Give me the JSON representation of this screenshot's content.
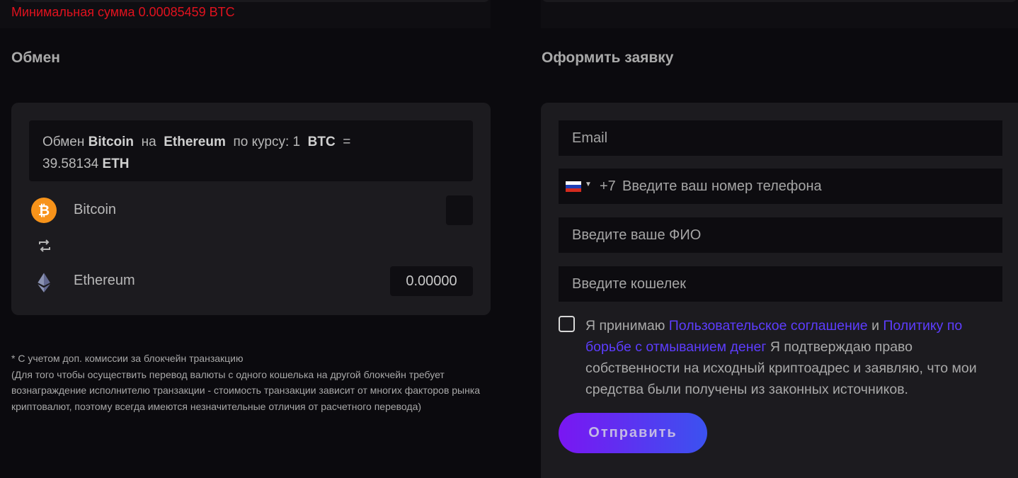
{
  "min_sum": "Минимальная сумма 0.00085459 BTC",
  "exchange": {
    "title": "Обмен",
    "rate": {
      "prefix": "Обмен",
      "from": "Bitcoin",
      "on": "на",
      "to": "Ethereum",
      "rate_label": "по курсу: 1",
      "from_code": "BTC",
      "equals": "=",
      "value": "39.58134",
      "to_code": "ETH"
    },
    "from_coin": {
      "name": "Bitcoin",
      "icon": "bitcoin-icon",
      "color": "#f7931a",
      "value": ""
    },
    "swap_icon": "swap-arrows-icon",
    "to_coin": {
      "name": "Ethereum",
      "icon": "ethereum-icon",
      "value": "0.00000"
    }
  },
  "note": {
    "line1": "* С учетом доп. комиссии за блокчейн транзакцию",
    "line2": "(Для того чтобы осуществить перевод валюты с одного кошелька на другой блокчейн требует вознаграждение исполнителю транзакции - стоимость транзакции зависит от многих факторов рынка криптовалют, поэтому всегда имеются незначительные отличия от расчетного перевода)"
  },
  "order": {
    "title": "Оформить заявку",
    "email_placeholder": "Email",
    "phone_code": "+7",
    "phone_placeholder": "Введите ваш номер телефона",
    "flag_icon": "russia-flag-icon",
    "name_placeholder": "Введите ваше ФИО",
    "wallet_placeholder": "Введите кошелек",
    "agree": {
      "t1": "Я принимаю",
      "link1": "Пользовательское соглашение",
      "t2": "и",
      "link2": "Политику по борьбе с отмыванием денег",
      "t3": "Я подтверждаю право собственности на исходный криптоадрес и заявляю, что мои средства были получены из законных источников."
    },
    "submit_label": "Отправить",
    "link_color": "#5d3dff",
    "error_color": "#e0121e"
  }
}
